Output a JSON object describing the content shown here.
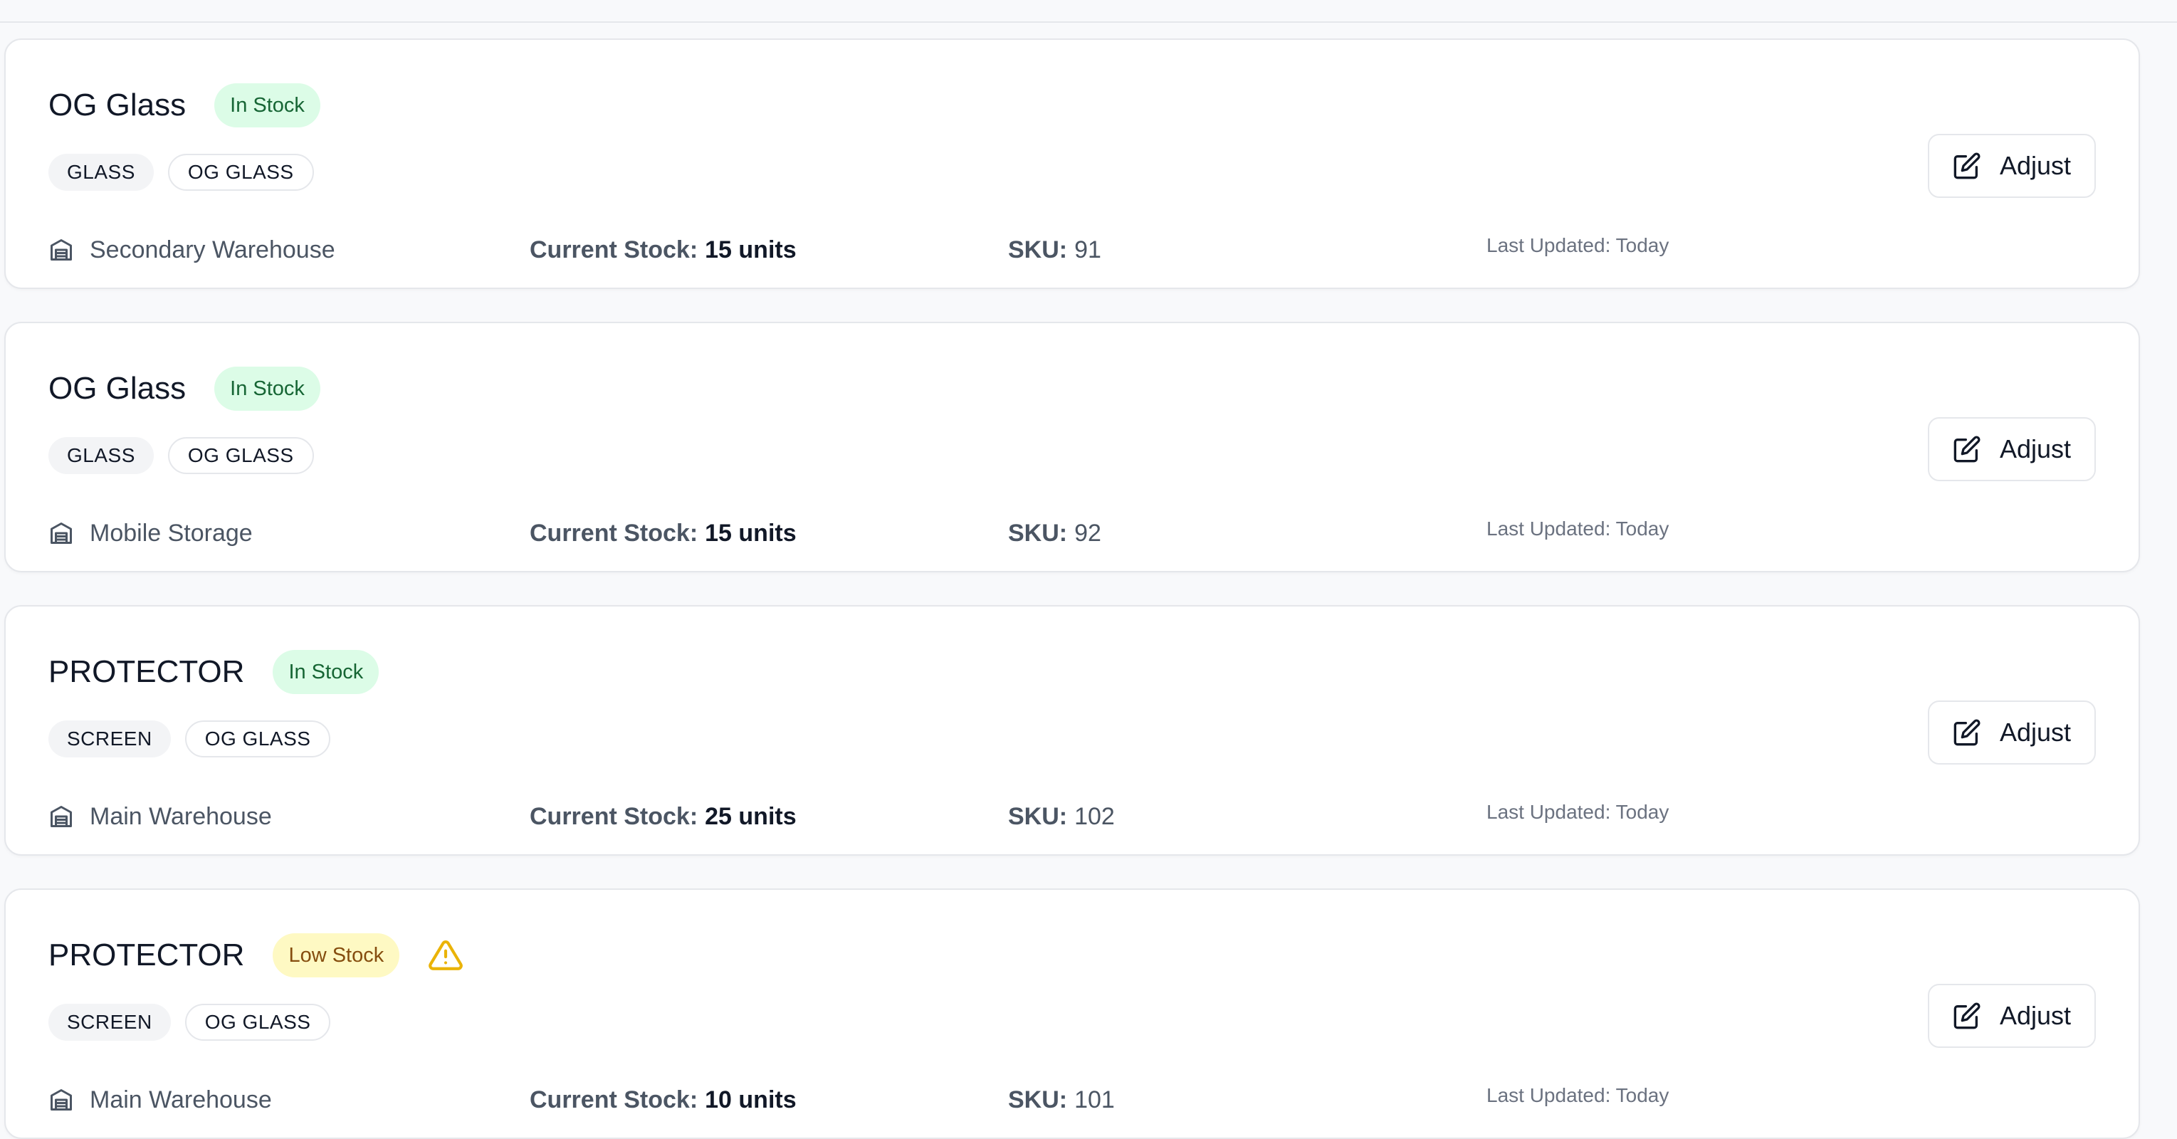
{
  "items": [
    {
      "name": "OG Glass",
      "status": "In Stock",
      "status_type": "in",
      "tags": [
        "GLASS",
        "OG GLASS"
      ],
      "location": "Secondary Warehouse",
      "stock_label": "Current Stock:",
      "stock_value": "15 units",
      "sku_label": "SKU:",
      "sku": "91",
      "last_updated": "Last Updated: Today",
      "action_label": "Adjust"
    },
    {
      "name": "OG Glass",
      "status": "In Stock",
      "status_type": "in",
      "tags": [
        "GLASS",
        "OG GLASS"
      ],
      "location": "Mobile Storage",
      "stock_label": "Current Stock:",
      "stock_value": "15 units",
      "sku_label": "SKU:",
      "sku": "92",
      "last_updated": "Last Updated: Today",
      "action_label": "Adjust"
    },
    {
      "name": "PROTECTOR",
      "status": "In Stock",
      "status_type": "in",
      "tags": [
        "SCREEN",
        "OG GLASS"
      ],
      "location": "Main Warehouse",
      "stock_label": "Current Stock:",
      "stock_value": "25 units",
      "sku_label": "SKU:",
      "sku": "102",
      "last_updated": "Last Updated: Today",
      "action_label": "Adjust"
    },
    {
      "name": "PROTECTOR",
      "status": "Low Stock",
      "status_type": "low",
      "warning_icon": "warning-triangle-icon",
      "tags": [
        "SCREEN",
        "OG GLASS"
      ],
      "location": "Main Warehouse",
      "stock_label": "Current Stock:",
      "stock_value": "10 units",
      "sku_label": "SKU:",
      "sku": "101",
      "last_updated": "Last Updated: Today",
      "action_label": "Adjust"
    }
  ],
  "icons": {
    "location": "warehouse-icon",
    "action": "edit-icon"
  },
  "colors": {
    "in_stock_bg": "#dcfce7",
    "in_stock_text": "#166534",
    "low_stock_bg": "#fef9c3",
    "low_stock_text": "#854d0e",
    "warning": "#eab308"
  }
}
